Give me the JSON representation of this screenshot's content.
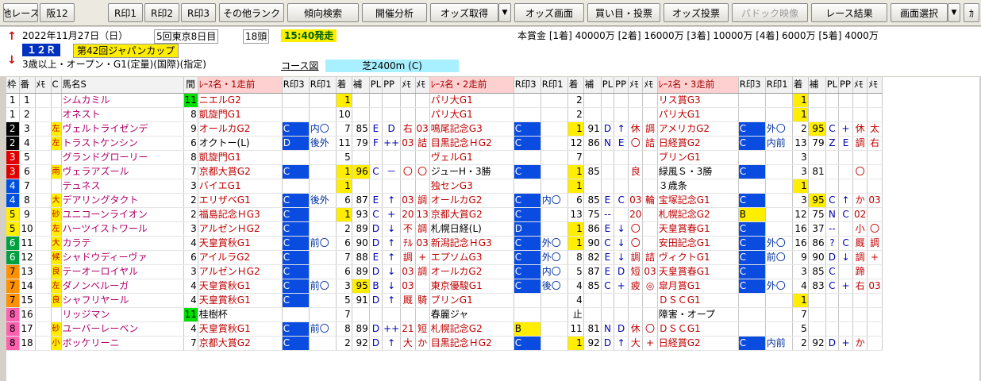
{
  "toolbar": {
    "items": [
      "他レース",
      "阪12",
      "",
      "R印1",
      "R印2",
      "R印3",
      "その他ランク",
      "傾向検索",
      "開催分析",
      "オッズ取得",
      "▼",
      "オッズ画面",
      "買い目・投票",
      "オッズ投票",
      "パドック映像",
      "レース結果",
      "画面選択",
      "▼",
      "ｶ"
    ]
  },
  "race": {
    "date": "2022年11月27日（日）",
    "kaisai": "5回東京8日目",
    "tousu": "18頭",
    "start": "15:40発走",
    "raceno": "１２Ｒ",
    "name": "第42回ジャパンカップ",
    "cond": "3歳以上・オープン・G1(定量)(国際)(指定)",
    "course_label": "コース図",
    "course": "芝2400m (C)",
    "prize": "本賞金 [1着] 40000万 [2着] 16000万 [3着] 10000万 [4着] 6000万 [5着] 4000万",
    "up_arrow": "↑",
    "down_arrow": "↓"
  },
  "headers": [
    "枠",
    "番",
    "ﾒﾓ",
    "C",
    "馬名S",
    "間",
    "ﾚｰｽ名・1走前",
    "R印3",
    "R印1",
    "着",
    "補",
    "PL",
    "PP",
    "ﾒﾓ",
    "ﾒﾓ",
    "ﾚｰｽ名・2走前",
    "R印3",
    "R印1",
    "着",
    "補",
    "PL",
    "PP",
    "ﾒﾓ",
    "ﾒﾓ",
    "ﾚｰｽ名・3走前",
    "R印3",
    "R印1",
    "着",
    "補",
    "PL",
    "PP",
    "ﾒﾓ",
    "ﾒﾓ"
  ],
  "waku_colors": {
    "1": "#ffffff",
    "2": "#000000",
    "3": "#e00000",
    "4": "#0050e0",
    "5": "#ffee00",
    "6": "#00a040",
    "7": "#ff9000",
    "8": "#ff60b0"
  },
  "rows": [
    {
      "w": "1",
      "n": "1",
      "c": "",
      "name": "シムカミル",
      "k": "11",
      "r1": [
        "ニエルG2",
        "",
        "",
        "1",
        "",
        "",
        "",
        "",
        ""
      ],
      "r2": [
        "パリ大G1",
        "",
        "",
        "2",
        "",
        "",
        "",
        "",
        ""
      ],
      "r3": [
        "リス賞G3",
        "",
        "",
        "1",
        "",
        "",
        "",
        "",
        ""
      ]
    },
    {
      "w": "1",
      "n": "2",
      "c": "",
      "name": "オネスト",
      "k": "8",
      "r1": [
        "凱旋門G1",
        "",
        "",
        "10",
        "",
        "",
        "",
        "",
        ""
      ],
      "r2": [
        "パリ大G1",
        "",
        "",
        "2",
        "",
        "",
        "",
        "",
        ""
      ],
      "r3": [
        "パリ大G1",
        "",
        "",
        "1",
        "",
        "",
        "",
        "",
        ""
      ]
    },
    {
      "w": "2",
      "n": "3",
      "c": "左",
      "name": "ヴェルトライゼンデ",
      "k": "9",
      "r1": [
        "オールカG2",
        "C",
        "内〇",
        "7",
        "85",
        "E",
        "D",
        "右",
        "03"
      ],
      "r2": [
        "鳴尾記念G3",
        "C",
        "",
        "1",
        "91",
        "D",
        "↑",
        "休",
        "調"
      ],
      "r3": [
        "アメリカG2",
        "C",
        "外〇",
        "2",
        "95",
        "C",
        "+",
        "休",
        "太"
      ]
    },
    {
      "w": "2",
      "n": "4",
      "c": "左",
      "name": "トラストケンシン",
      "k": "6",
      "r1": [
        "オクトー(L)",
        "D",
        "後外",
        "11",
        "79",
        "F",
        "++",
        "03",
        "詰"
      ],
      "r2": [
        "目黒記念ＨG2",
        "C",
        "",
        "12",
        "86",
        "N",
        "E",
        "〇",
        "詰"
      ],
      "r3": [
        "日経賞G2",
        "C",
        "内前",
        "13",
        "79",
        "Z",
        "E",
        "調",
        "右"
      ]
    },
    {
      "w": "3",
      "n": "5",
      "c": "",
      "name": "グランドグローリー",
      "k": "8",
      "r1": [
        "凱旋門G1",
        "",
        "",
        "5",
        "",
        "",
        "",
        "",
        ""
      ],
      "r2": [
        "ヴェルG1",
        "",
        "",
        "7",
        "",
        "",
        "",
        "",
        ""
      ],
      "r3": [
        "ブリンG1",
        "",
        "",
        "3",
        "",
        "",
        "",
        "",
        ""
      ]
    },
    {
      "w": "3",
      "n": "6",
      "c": "雨",
      "name": "ヴェラアズール",
      "k": "7",
      "r1": [
        "京都大賞G2",
        "C",
        "",
        "1",
        "96",
        "C",
        "－",
        "〇",
        "〇"
      ],
      "r2": [
        "ジューH・3勝",
        "C",
        "",
        "1",
        "85",
        "",
        "",
        "良",
        ""
      ],
      "r3": [
        "緑風Ｓ・3勝",
        "C",
        "",
        "3",
        "81",
        "",
        "",
        "〇",
        ""
      ]
    },
    {
      "w": "4",
      "n": "7",
      "c": "",
      "name": "テュネス",
      "k": "3",
      "r1": [
        "バイエG1",
        "",
        "",
        "1",
        "",
        "",
        "",
        "",
        ""
      ],
      "r2": [
        "独センG3",
        "",
        "",
        "1",
        "",
        "",
        "",
        "",
        ""
      ],
      "r3": [
        "３歳条",
        "",
        "",
        "1",
        "",
        "",
        "",
        "",
        ""
      ]
    },
    {
      "w": "4",
      "n": "8",
      "c": "大",
      "name": "デアリングタクト",
      "k": "2",
      "r1": [
        "エリザベG1",
        "C",
        "後外",
        "6",
        "87",
        "E",
        "↑",
        "03",
        "調"
      ],
      "r2": [
        "オールカG2",
        "C",
        "内〇",
        "6",
        "85",
        "E",
        "C",
        "03",
        "輪"
      ],
      "r3": [
        "宝塚記念G1",
        "C",
        "",
        "3",
        "95",
        "C",
        "↑",
        "か",
        "03"
      ]
    },
    {
      "w": "5",
      "n": "9",
      "c": "砂",
      "name": "ユニコーンライオン",
      "k": "2",
      "r1": [
        "福島記念ＨG3",
        "C",
        "",
        "1",
        "93",
        "C",
        "+",
        "20",
        "13"
      ],
      "r2": [
        "京都大賞G2",
        "C",
        "",
        "13",
        "75",
        "--",
        "",
        "20",
        ""
      ],
      "r3": [
        "札幌記念G2",
        "B",
        "",
        "12",
        "75",
        "N",
        "C",
        "02",
        ""
      ]
    },
    {
      "w": "5",
      "n": "10",
      "c": "左",
      "name": "ハーツイストワール",
      "k": "3",
      "r1": [
        "アルゼンＨG2",
        "C",
        "",
        "2",
        "89",
        "D",
        "↓",
        "不",
        "調"
      ],
      "r2": [
        "札幌日経(L)",
        "D",
        "",
        "1",
        "86",
        "E",
        "↓",
        "〇",
        ""
      ],
      "r3": [
        "天皇賞春G1",
        "C",
        "",
        "16",
        "37",
        "--",
        "",
        "小",
        "〇"
      ]
    },
    {
      "w": "6",
      "n": "11",
      "c": "大",
      "name": "カラテ",
      "k": "4",
      "r1": [
        "天皇賞秋G1",
        "C",
        "前〇",
        "6",
        "90",
        "D",
        "↑",
        "ﾁﾙ",
        "03"
      ],
      "r2": [
        "新潟記念ＨG3",
        "C",
        "外〇",
        "1",
        "90",
        "C",
        "↓",
        "〇",
        ""
      ],
      "r3": [
        "安田記念G1",
        "C",
        "外〇",
        "16",
        "86",
        "?",
        "C",
        "厩",
        "調"
      ]
    },
    {
      "w": "6",
      "n": "12",
      "c": "候",
      "name": "シャドウディーヴァ",
      "k": "6",
      "r1": [
        "アイルラG2",
        "C",
        "",
        "7",
        "88",
        "E",
        "↑",
        "調",
        "+"
      ],
      "r2": [
        "エプソムG3",
        "C",
        "外〇",
        "8",
        "82",
        "E",
        "↓",
        "調",
        "詰"
      ],
      "r3": [
        "ヴィクトG1",
        "C",
        "前〇",
        "9",
        "90",
        "D",
        "↓",
        "調",
        "+"
      ]
    },
    {
      "w": "7",
      "n": "13",
      "c": "良",
      "name": "テーオーロイヤル",
      "k": "3",
      "r1": [
        "アルゼンＨG2",
        "C",
        "",
        "6",
        "89",
        "D",
        "↓",
        "03",
        "調"
      ],
      "r2": [
        "オールカG2",
        "C",
        "内〇",
        "5",
        "87",
        "E",
        "D",
        "短",
        "03"
      ],
      "r3": [
        "天皇賞春G1",
        "C",
        "",
        "3",
        "85",
        "C",
        "",
        "蹄",
        ""
      ]
    },
    {
      "w": "7",
      "n": "14",
      "c": "左",
      "name": "ダノンベルーガ",
      "k": "4",
      "r1": [
        "天皇賞秋G1",
        "C",
        "前〇",
        "3",
        "95",
        "B",
        "↓",
        "03",
        ""
      ],
      "r2": [
        "東京優駿G1",
        "C",
        "後〇",
        "4",
        "85",
        "C",
        "+",
        "疲",
        "◎"
      ],
      "r3": [
        "皐月賞G1",
        "C",
        "外〇",
        "4",
        "83",
        "C",
        "+",
        "右",
        "03"
      ]
    },
    {
      "w": "7",
      "n": "15",
      "c": "良",
      "name": "シャフリヤール",
      "k": "4",
      "r1": [
        "天皇賞秋G1",
        "C",
        "",
        "5",
        "91",
        "D",
        "↑",
        "厩",
        "騎"
      ],
      "r2": [
        "ブリンG1",
        "",
        "",
        "4",
        "",
        "",
        "",
        "",
        ""
      ],
      "r3": [
        "ＤＳＣG1",
        "",
        "",
        "1",
        "",
        "",
        "",
        "",
        ""
      ]
    },
    {
      "w": "8",
      "n": "16",
      "c": "",
      "name": "リッジマン",
      "k": "11",
      "r1": [
        "桂樹杯",
        "",
        "",
        "7",
        "",
        "",
        "",
        "",
        ""
      ],
      "r2": [
        "春麗ジャ",
        "",
        "",
        "止",
        "",
        "",
        "",
        "",
        ""
      ],
      "r3": [
        "障害・オープ",
        "",
        "",
        "7",
        "",
        "",
        "",
        "",
        ""
      ]
    },
    {
      "w": "8",
      "n": "17",
      "c": "砂",
      "name": "ユーバーレーベン",
      "k": "4",
      "r1": [
        "天皇賞秋G1",
        "C",
        "前〇",
        "8",
        "89",
        "D",
        "++",
        "21",
        "短"
      ],
      "r2": [
        "札幌記念G2",
        "B",
        "",
        "11",
        "81",
        "N",
        "D",
        "休",
        "〇"
      ],
      "r3": [
        "ＤＳＣG1",
        "",
        "",
        "5",
        "",
        "",
        "",
        "",
        ""
      ]
    },
    {
      "w": "8",
      "n": "18",
      "c": "小",
      "name": "ボッケリーニ",
      "k": "7",
      "r1": [
        "京都大賞G2",
        "C",
        "",
        "2",
        "92",
        "D",
        "↑",
        "大",
        "か"
      ],
      "r2": [
        "目黒記念ＨG2",
        "C",
        "",
        "1",
        "92",
        "D",
        "↑",
        "大",
        "+"
      ],
      "r3": [
        "日経賞G2",
        "C",
        "内前",
        "2",
        "92",
        "D",
        "+",
        "か",
        ""
      ]
    }
  ]
}
